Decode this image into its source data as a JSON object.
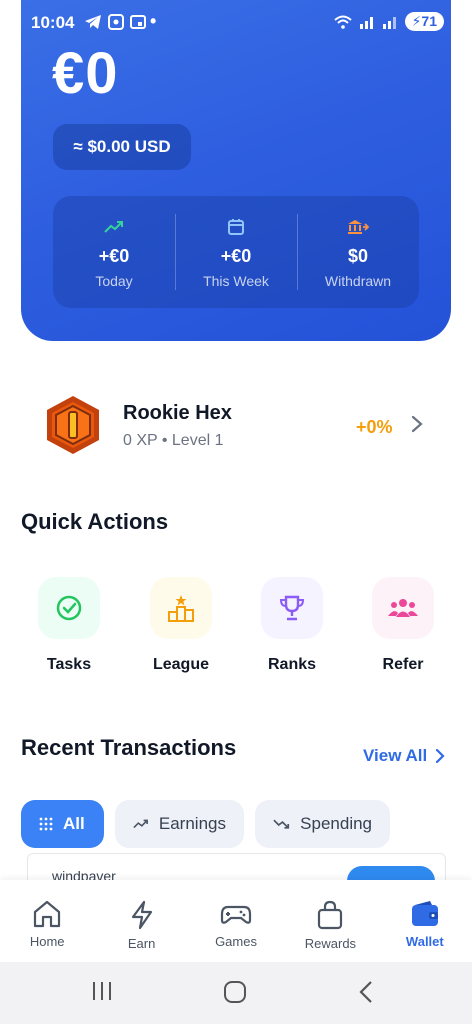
{
  "status_bar": {
    "time": "10:04",
    "battery": "71"
  },
  "wallet": {
    "balance": "€0",
    "usd_equivalent": "≈ $0.00 USD",
    "stats": [
      {
        "value": "+€0",
        "label": "Today",
        "icon": "trending-up-icon"
      },
      {
        "value": "+€0",
        "label": "This Week",
        "icon": "calendar-icon"
      },
      {
        "value": "$0",
        "label": "Withdrawn",
        "icon": "bank-icon"
      }
    ]
  },
  "level": {
    "name": "Rookie Hex",
    "subtitle": "0 XP • Level 1",
    "progress": "+0%"
  },
  "quick_actions": {
    "title": "Quick Actions",
    "items": [
      {
        "label": "Tasks",
        "icon": "check-circle-icon",
        "color": "#22c55e"
      },
      {
        "label": "League",
        "icon": "podium-icon",
        "color": "#f59e0b"
      },
      {
        "label": "Ranks",
        "icon": "trophy-icon",
        "color": "#8b5cf6"
      },
      {
        "label": "Refer",
        "icon": "users-icon",
        "color": "#ec4899"
      }
    ]
  },
  "transactions": {
    "title": "Recent Transactions",
    "view_all": "View All",
    "filters": [
      "All",
      "Earnings",
      "Spending"
    ],
    "preview_name": "windpaver"
  },
  "bottom_nav": [
    {
      "label": "Home",
      "icon": "home-icon"
    },
    {
      "label": "Earn",
      "icon": "lightning-icon"
    },
    {
      "label": "Games",
      "icon": "gamepad-icon"
    },
    {
      "label": "Rewards",
      "icon": "bag-icon"
    },
    {
      "label": "Wallet",
      "icon": "wallet-icon",
      "active": true
    }
  ],
  "colors": {
    "primary": "#2f5fe0",
    "accent_blue": "#2f6be4",
    "orange": "#f59e0b"
  }
}
